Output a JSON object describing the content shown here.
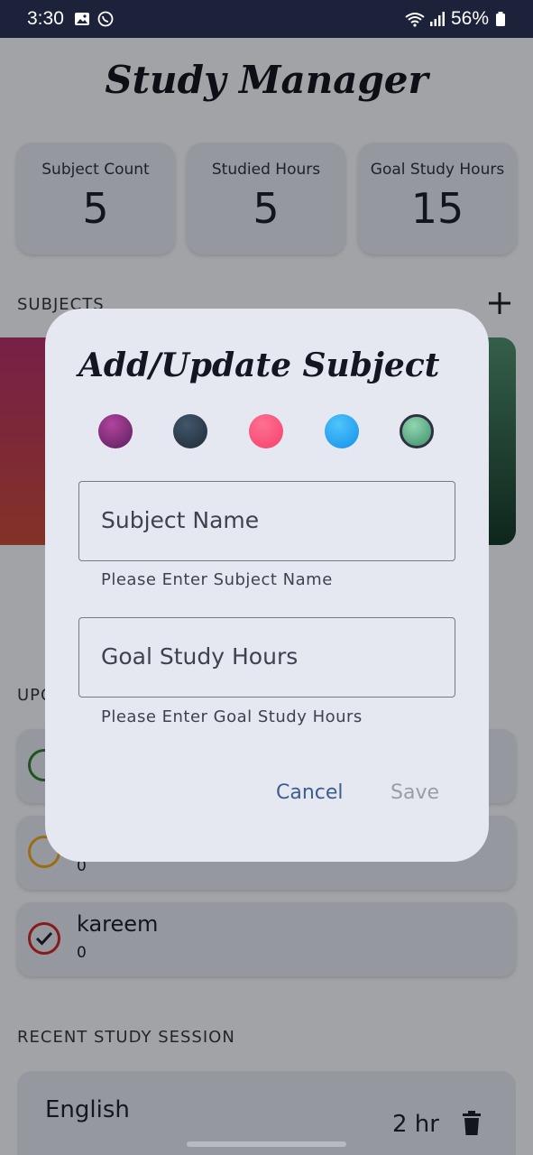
{
  "status_bar": {
    "time": "3:30",
    "battery": "56%"
  },
  "app": {
    "title": "Study Manager",
    "cards": [
      {
        "label": "Subject Count",
        "value": "5"
      },
      {
        "label": "Studied Hours",
        "value": "5"
      },
      {
        "label": "Goal Study Hours",
        "value": "15"
      }
    ],
    "subjects_label": "SUBJECTS",
    "upcoming_label": "UPC",
    "tasks": [
      {
        "name": "",
        "sub": "",
        "color": "#2e7d32"
      },
      {
        "name": "",
        "sub": "0",
        "color": "#e0a21a"
      },
      {
        "name": "kareem",
        "sub": "0",
        "color": "#c62828"
      }
    ],
    "recent_label": "RECENT STUDY SESSION",
    "session": {
      "name": "English",
      "hours": "2 hr"
    }
  },
  "dialog": {
    "title": "Add/Update Subject",
    "swatches": [
      {
        "name": "purple",
        "color": "#7b2a7a"
      },
      {
        "name": "dark-slate",
        "color": "#2d3e50"
      },
      {
        "name": "pink",
        "color": "#ff4f7f"
      },
      {
        "name": "blue",
        "color": "#1ea8f5"
      },
      {
        "name": "green",
        "color": "#6fc39a"
      }
    ],
    "subject_name_placeholder": "Subject Name",
    "subject_name_helper": "Please Enter Subject Name",
    "goal_hours_placeholder": "Goal Study Hours",
    "goal_hours_helper": "Please Enter Goal Study Hours",
    "cancel_label": "Cancel",
    "save_label": "Save"
  }
}
